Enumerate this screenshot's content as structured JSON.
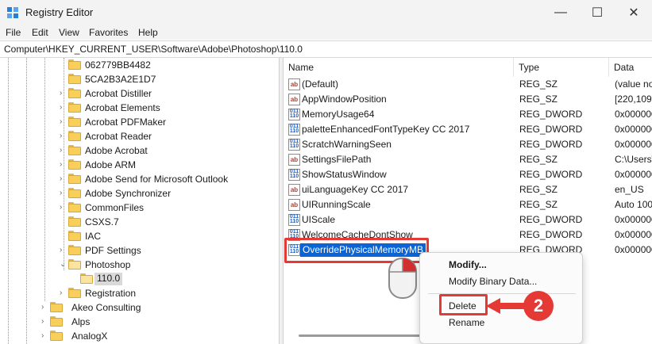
{
  "window": {
    "title": "Registry Editor",
    "minimize_glyph": "—",
    "maximize_glyph": "☐",
    "close_glyph": "✕"
  },
  "menu": [
    "File",
    "Edit",
    "View",
    "Favorites",
    "Help"
  ],
  "address": "Computer\\HKEY_CURRENT_USER\\Software\\Adobe\\Photoshop\\110.0",
  "tree": [
    {
      "label": "062779BB4482",
      "expander": ""
    },
    {
      "label": "5CA2B3A2E1D7",
      "expander": ""
    },
    {
      "label": "Acrobat Distiller",
      "expander": "›"
    },
    {
      "label": "Acrobat Elements",
      "expander": "›"
    },
    {
      "label": "Acrobat PDFMaker",
      "expander": "›"
    },
    {
      "label": "Acrobat Reader",
      "expander": "›"
    },
    {
      "label": "Adobe Acrobat",
      "expander": "›"
    },
    {
      "label": "Adobe ARM",
      "expander": "›"
    },
    {
      "label": "Adobe Send for Microsoft Outlook",
      "expander": "›"
    },
    {
      "label": "Adobe Synchronizer",
      "expander": "›"
    },
    {
      "label": "CommonFiles",
      "expander": "›"
    },
    {
      "label": "CSXS.7",
      "expander": ""
    },
    {
      "label": "IAC",
      "expander": ""
    },
    {
      "label": "PDF Settings",
      "expander": "›"
    },
    {
      "label": "Photoshop",
      "expander": "⌄"
    },
    {
      "label": "110.0",
      "expander": "",
      "selected": true
    },
    {
      "label": "Registration",
      "expander": "›"
    },
    {
      "label": "Akeo Consulting",
      "expander": "›"
    },
    {
      "label": "Alps",
      "expander": "›"
    },
    {
      "label": "AnalogX",
      "expander": "›"
    }
  ],
  "columns": {
    "name": "Name",
    "type": "Type",
    "data": "Data"
  },
  "values": [
    {
      "name": "(Default)",
      "type": "REG_SZ",
      "data": "(value no",
      "kind": "sz"
    },
    {
      "name": "AppWindowPosition",
      "type": "REG_SZ",
      "data": "[220,109,",
      "kind": "sz"
    },
    {
      "name": "MemoryUsage64",
      "type": "REG_DWORD",
      "data": "0x000000",
      "kind": "dword"
    },
    {
      "name": "paletteEnhancedFontTypeKey CC 2017",
      "type": "REG_DWORD",
      "data": "0x000000",
      "kind": "dword"
    },
    {
      "name": "ScratchWarningSeen",
      "type": "REG_DWORD",
      "data": "0x000000",
      "kind": "dword"
    },
    {
      "name": "SettingsFilePath",
      "type": "REG_SZ",
      "data": "C:\\Users\\",
      "kind": "sz"
    },
    {
      "name": "ShowStatusWindow",
      "type": "REG_DWORD",
      "data": "0x000000",
      "kind": "dword"
    },
    {
      "name": "uiLanguageKey CC 2017",
      "type": "REG_SZ",
      "data": "en_US",
      "kind": "sz"
    },
    {
      "name": "UIRunningScale",
      "type": "REG_SZ",
      "data": "Auto 100",
      "kind": "sz"
    },
    {
      "name": "UIScale",
      "type": "REG_DWORD",
      "data": "0x000000",
      "kind": "dword"
    },
    {
      "name": "WelcomeCacheDontShow",
      "type": "REG_DWORD",
      "data": "0x000000",
      "kind": "dword"
    },
    {
      "name": "OverridePhysicalMemoryMB",
      "type": "REG_DWORD",
      "data": "0x000000",
      "kind": "dword",
      "selected": true
    }
  ],
  "icon_text": {
    "sz": "ab",
    "dword": "011\n110"
  },
  "context_menu": {
    "modify": "Modify...",
    "modify_binary": "Modify Binary Data...",
    "delete": "Delete",
    "rename": "Rename"
  },
  "annotation": {
    "step": "2",
    "color": "#e53935"
  },
  "colors": {
    "selection": "#0a64d6",
    "folder": "#f7cf5a",
    "chrome": "#f3f3f3"
  }
}
